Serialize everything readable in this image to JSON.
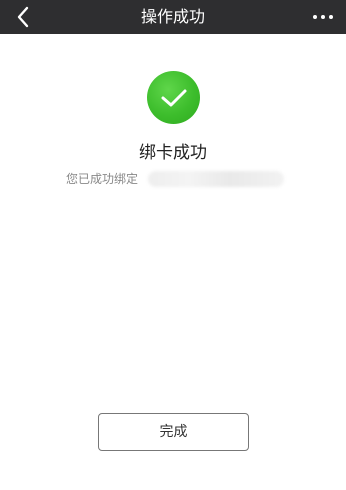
{
  "navbar": {
    "title": "操作成功",
    "back_icon": "chevron-left-icon",
    "more_icon": "more-dots-icon"
  },
  "result": {
    "icon": "check-circle-icon",
    "icon_color": "#3dbd2c",
    "title": "绑卡成功",
    "description": "您已成功绑定"
  },
  "actions": {
    "done_label": "完成"
  },
  "colors": {
    "navbar_background": "#2e2e30",
    "accent": "#3dbd2c"
  }
}
